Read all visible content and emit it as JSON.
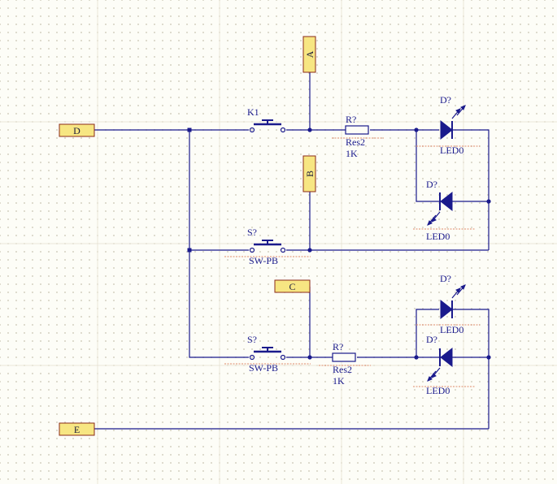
{
  "ports": {
    "A": "A",
    "B": "B",
    "C": "C",
    "D": "D",
    "E": "E"
  },
  "components": {
    "k1": {
      "designator": "K1"
    },
    "s1": {
      "designator": "S?",
      "comment": "SW-PB"
    },
    "s2": {
      "designator": "S?",
      "comment": "SW-PB"
    },
    "r1": {
      "designator": "R?",
      "comment": "Res2",
      "value": "1K"
    },
    "r2": {
      "designator": "R?",
      "comment": "Res2",
      "value": "1K"
    },
    "d1": {
      "designator": "D?",
      "comment": "LED0"
    },
    "d2": {
      "designator": "D?",
      "comment": "LED0"
    },
    "d3": {
      "designator": "D?",
      "comment": "LED0"
    },
    "d4": {
      "designator": "D?",
      "comment": "LED0"
    }
  },
  "colors": {
    "wire": "#1a1a8c",
    "port_fill": "#f7e682",
    "port_border": "#8a2a1a",
    "background": "#fdfdf7",
    "grid": "#d7d3c4",
    "error_marker": "#e08a6a"
  }
}
